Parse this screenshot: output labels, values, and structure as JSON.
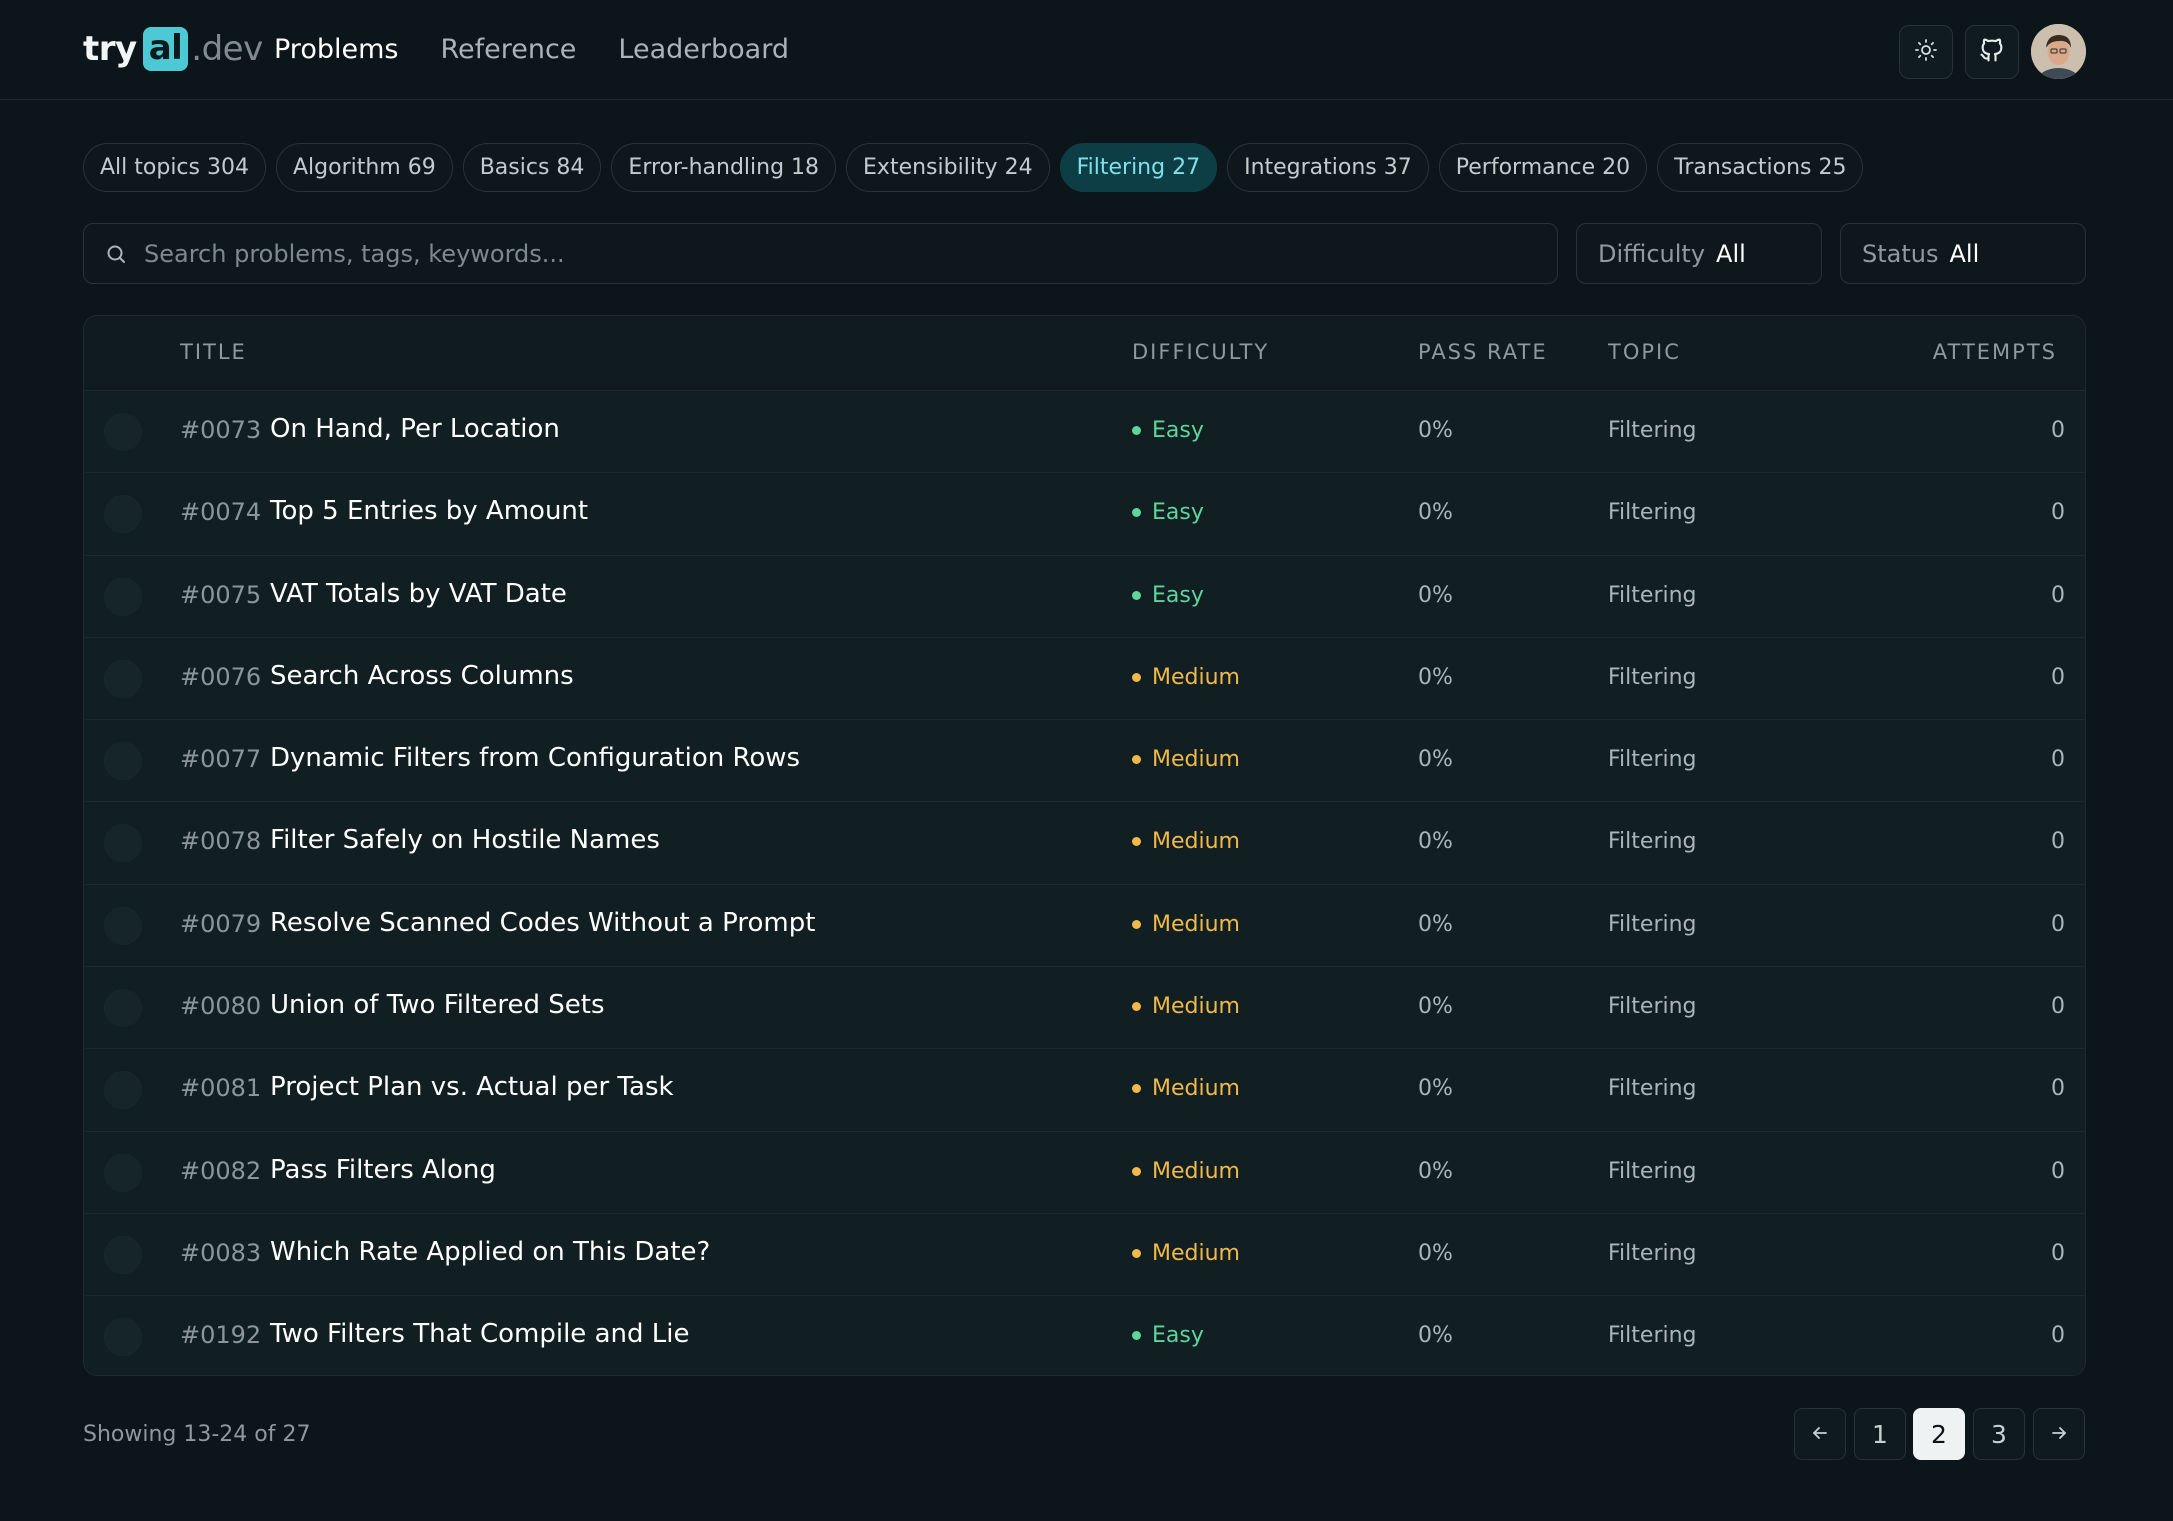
{
  "brand": {
    "try": "try",
    "al": "al",
    "dev": ".dev"
  },
  "nav": {
    "items": [
      {
        "label": "Problems",
        "active": true
      },
      {
        "label": "Reference",
        "active": false
      },
      {
        "label": "Leaderboard",
        "active": false
      }
    ]
  },
  "header_actions": {
    "theme_icon": "sun-icon",
    "github_icon": "github-icon",
    "avatar": "user-avatar"
  },
  "topics": [
    {
      "label": "All topics 304",
      "active": false
    },
    {
      "label": "Algorithm 69",
      "active": false
    },
    {
      "label": "Basics 84",
      "active": false
    },
    {
      "label": "Error-handling 18",
      "active": false
    },
    {
      "label": "Extensibility 24",
      "active": false
    },
    {
      "label": "Filtering 27",
      "active": true
    },
    {
      "label": "Integrations 37",
      "active": false
    },
    {
      "label": "Performance 20",
      "active": false
    },
    {
      "label": "Transactions 25",
      "active": false
    }
  ],
  "search": {
    "placeholder": "Search problems, tags, keywords...",
    "value": ""
  },
  "filters": {
    "difficulty": {
      "label": "Difficulty",
      "value": "All"
    },
    "status": {
      "label": "Status",
      "value": "All"
    }
  },
  "table": {
    "headers": {
      "title": "TITLE",
      "difficulty": "DIFFICULTY",
      "pass_rate": "PASS RATE",
      "topic": "TOPIC",
      "attempts": "ATTEMPTS"
    },
    "rows": [
      {
        "num": "#0073",
        "title": "On Hand, Per Location",
        "difficulty": "Easy",
        "pass_rate": "0%",
        "topic": "Filtering",
        "attempts": "0"
      },
      {
        "num": "#0074",
        "title": "Top 5 Entries by Amount",
        "difficulty": "Easy",
        "pass_rate": "0%",
        "topic": "Filtering",
        "attempts": "0"
      },
      {
        "num": "#0075",
        "title": "VAT Totals by VAT Date",
        "difficulty": "Easy",
        "pass_rate": "0%",
        "topic": "Filtering",
        "attempts": "0"
      },
      {
        "num": "#0076",
        "title": "Search Across Columns",
        "difficulty": "Medium",
        "pass_rate": "0%",
        "topic": "Filtering",
        "attempts": "0"
      },
      {
        "num": "#0077",
        "title": "Dynamic Filters from Configuration Rows",
        "difficulty": "Medium",
        "pass_rate": "0%",
        "topic": "Filtering",
        "attempts": "0"
      },
      {
        "num": "#0078",
        "title": "Filter Safely on Hostile Names",
        "difficulty": "Medium",
        "pass_rate": "0%",
        "topic": "Filtering",
        "attempts": "0"
      },
      {
        "num": "#0079",
        "title": "Resolve Scanned Codes Without a Prompt",
        "difficulty": "Medium",
        "pass_rate": "0%",
        "topic": "Filtering",
        "attempts": "0"
      },
      {
        "num": "#0080",
        "title": "Union of Two Filtered Sets",
        "difficulty": "Medium",
        "pass_rate": "0%",
        "topic": "Filtering",
        "attempts": "0"
      },
      {
        "num": "#0081",
        "title": "Project Plan vs. Actual per Task",
        "difficulty": "Medium",
        "pass_rate": "0%",
        "topic": "Filtering",
        "attempts": "0"
      },
      {
        "num": "#0082",
        "title": "Pass Filters Along",
        "difficulty": "Medium",
        "pass_rate": "0%",
        "topic": "Filtering",
        "attempts": "0"
      },
      {
        "num": "#0083",
        "title": "Which Rate Applied on This Date?",
        "difficulty": "Medium",
        "pass_rate": "0%",
        "topic": "Filtering",
        "attempts": "0"
      },
      {
        "num": "#0192",
        "title": "Two Filters That Compile and Lie",
        "difficulty": "Easy",
        "pass_rate": "0%",
        "topic": "Filtering",
        "attempts": "0"
      }
    ]
  },
  "footer": {
    "showing": "Showing 13-24 of 27",
    "prev_icon": "arrow-left-icon",
    "next_icon": "arrow-right-icon",
    "pages": [
      "1",
      "2",
      "3"
    ],
    "current_page": "2"
  },
  "colors": {
    "background": "#0c1519",
    "accent": "#4cc9d4",
    "active_chip_bg": "#0e3e45",
    "easy": "#5ed59a",
    "medium": "#f0b94a"
  }
}
